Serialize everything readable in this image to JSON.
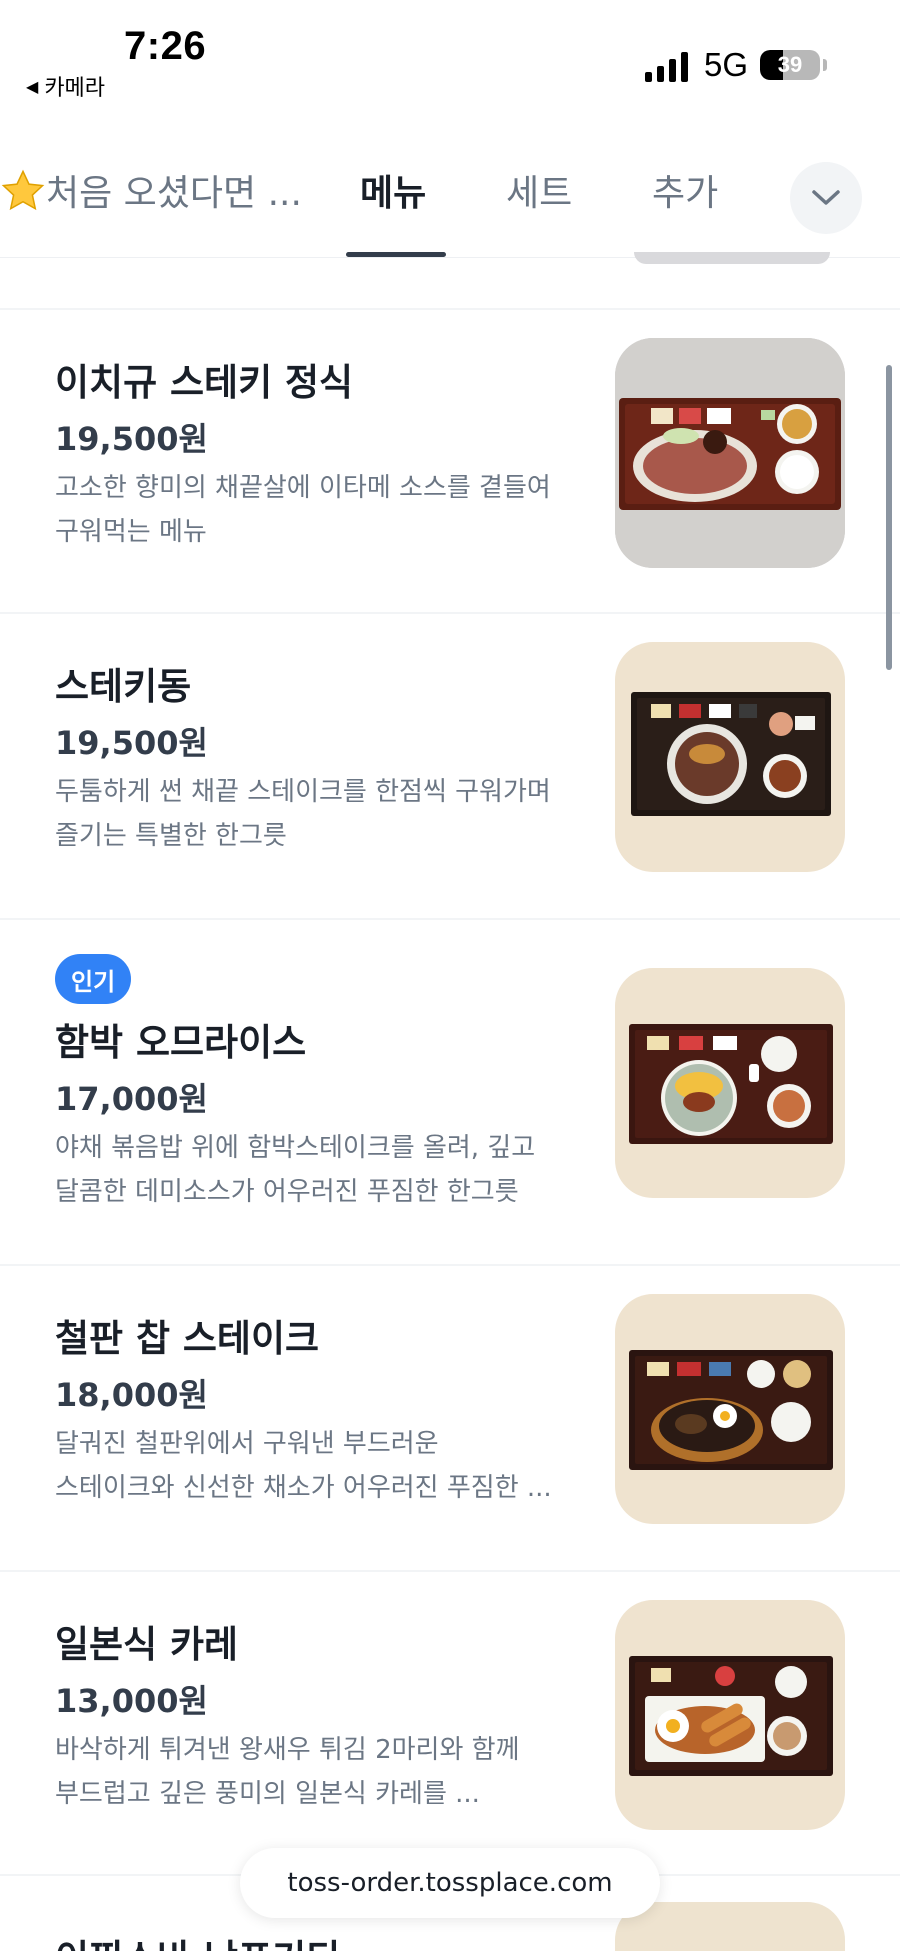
{
  "status_bar": {
    "time": "7:26",
    "back_app_label": "카메라",
    "network": "5G",
    "battery_percent": "39",
    "battery_level": 0.39
  },
  "tabs": [
    {
      "label": "처음 오셨다면 ...",
      "icon": "star-icon",
      "active": false
    },
    {
      "label": "메뉴",
      "active": true
    },
    {
      "label": "세트",
      "active": false
    },
    {
      "label": "추가",
      "active": false
    }
  ],
  "menu_items": [
    {
      "badge": "",
      "name": "이치규 스테키 정식",
      "price": "19,500원",
      "desc": [
        "고소한 향미의 채끝살에 이타메 소스를 곁들여",
        "구워먹는 메뉴"
      ],
      "photo_bg": "#cfcfcf"
    },
    {
      "badge": "",
      "name": "스테키동",
      "price": "19,500원",
      "desc": [
        "두툼하게 썬 채끝 스테이크를 한점씩 구워가며",
        "즐기는 특별한 한그릇"
      ],
      "photo_bg": "#efe3cf"
    },
    {
      "badge": "인기",
      "name": "함박 오므라이스",
      "price": "17,000원",
      "desc": [
        "야채 볶음밥 위에 함박스테이크를 올려, 깊고",
        "달콤한 데미소스가 어우러진 푸짐한 한그릇"
      ],
      "photo_bg": "#efe3cf"
    },
    {
      "badge": "",
      "name": "철판 찹 스테이크",
      "price": "18,000원",
      "desc": [
        "달궈진 철판위에서 구워낸 부드러운",
        "스테이크와 신선한 채소가 어우러진 푸짐한 ..."
      ],
      "photo_bg": "#efe3cf"
    },
    {
      "badge": "",
      "name": "일본식 카레",
      "price": "13,000원",
      "desc": [
        "바삭하게 튀겨낸 왕새우 튀김 2마리와 함께",
        "부드럽고 깊은 풍미의 일본식 카레를 ..."
      ],
      "photo_bg": "#efe3cf"
    }
  ],
  "next_item_peek": "이찌스바 낫포기티",
  "url_bar": "toss-order.tossplace.com"
}
